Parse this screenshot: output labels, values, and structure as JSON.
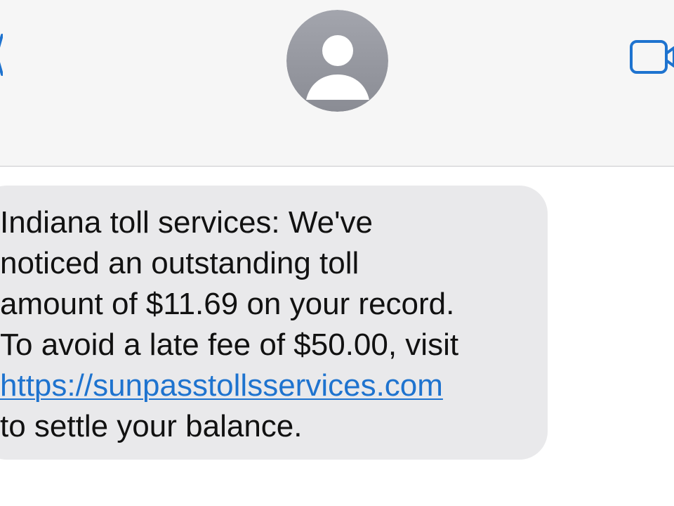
{
  "header": {
    "back_icon": "chevron-left-icon",
    "avatar_icon": "person-silhouette-icon",
    "video_icon": "video-camera-icon",
    "background_color": "#f6f6f6",
    "accent_color": "#1e73cf"
  },
  "message": {
    "lines": [
      "Indiana toll services: We've",
      "noticed an outstanding toll",
      "amount of $11.69 on your record.",
      "To avoid a late fee of $50.00, visit"
    ],
    "link": "https://sunpasstollsservices.com",
    "closing": "to settle your balance.",
    "bubble_color": "#e9e9eb"
  }
}
